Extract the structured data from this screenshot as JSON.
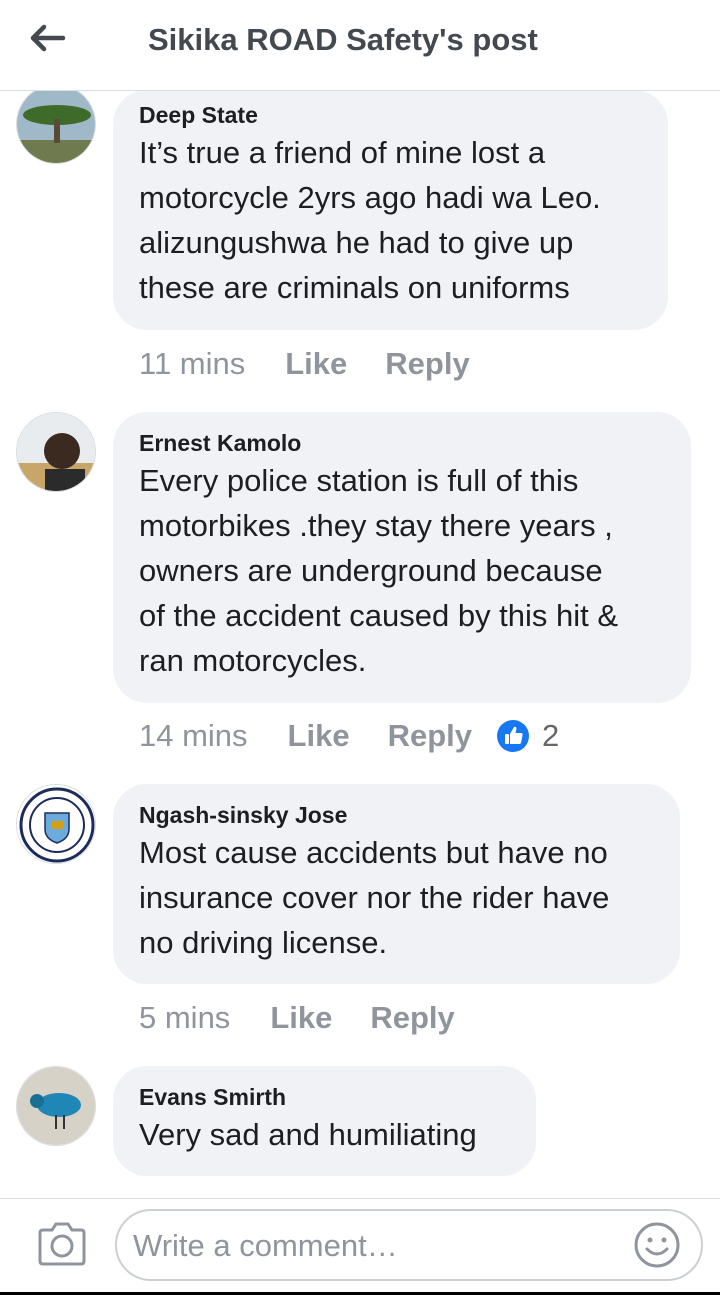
{
  "header": {
    "title": "Sikika ROAD Safety's post"
  },
  "comments": [
    {
      "author": "Deep State",
      "lines": [
        "It’s true a friend of mine lost a",
        "motorcycle 2yrs ago hadi wa Leo.",
        "alizungushwa he had to give up",
        "these are criminals on uniforms"
      ],
      "time": "11 mins",
      "like": "Like",
      "reply": "Reply"
    },
    {
      "author": "Ernest Kamolo",
      "lines": [
        "Every police station is full of this",
        "motorbikes .they stay there years ,",
        "owners are underground because",
        "of the accident caused by this hit &",
        "ran motorcycles."
      ],
      "time": "14 mins",
      "like": "Like",
      "reply": "Reply",
      "reaction_count": "2"
    },
    {
      "author": "Ngash-sinsky Jose",
      "lines": [
        "Most cause accidents but have no",
        "insurance cover nor the rider have",
        "no driving license."
      ],
      "time": "5 mins",
      "like": "Like",
      "reply": "Reply"
    },
    {
      "author": "Evans Smirth",
      "lines": [
        "Very sad and humiliating"
      ]
    }
  ],
  "composer": {
    "placeholder": "Write a comment…"
  },
  "colors": {
    "bubble": "#f0f2f5",
    "like_blue": "#1877f2",
    "muted": "#90949c"
  }
}
